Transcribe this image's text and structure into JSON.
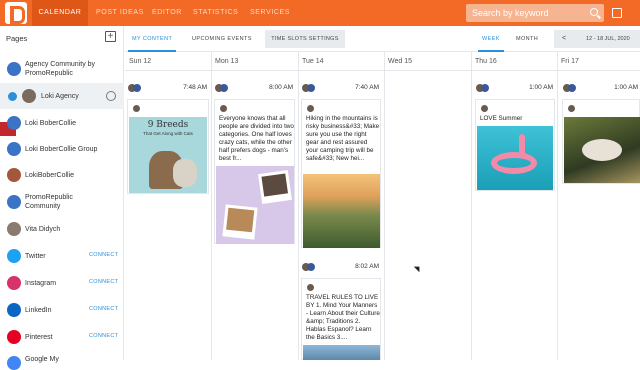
{
  "nav": {
    "tabs": [
      "CALENDAR",
      "POST IDEAS",
      "EDITOR",
      "STATISTICS",
      "SERVICES"
    ],
    "active": 0
  },
  "search": {
    "placeholder": "Search by keyword"
  },
  "sidebar": {
    "heading": "Pages",
    "items": [
      {
        "label": "Agency Community by PromoRepublic",
        "connect": ""
      },
      {
        "label": "Loki Agency",
        "connect": ""
      },
      {
        "label": "Loki BoberCollie",
        "connect": ""
      },
      {
        "label": "Loki BoberCollie Group",
        "connect": ""
      },
      {
        "label": "LokiBoberCollie",
        "connect": ""
      },
      {
        "label": "PromoRepublic Community",
        "connect": ""
      },
      {
        "label": "Vita Didych",
        "connect": ""
      },
      {
        "label": "Twitter",
        "connect": "CONNECT"
      },
      {
        "label": "Instagram",
        "connect": "CONNECT"
      },
      {
        "label": "LinkedIn",
        "connect": "CONNECT"
      },
      {
        "label": "Pinterest",
        "connect": "CONNECT"
      },
      {
        "label": "Google My",
        "connect": ""
      }
    ]
  },
  "subtabs": {
    "my_content": "MY CONTENT",
    "upcoming": "UPCOMING EVENTS",
    "time_slots": "TIME SLOTS SETTINGS",
    "week": "WEEK",
    "month": "MONTH",
    "range": "12 - 18 JUL, 2020",
    "prev": "<"
  },
  "days": [
    "Sun 12",
    "Mon 13",
    "Tue 14",
    "Wed 15",
    "Thu 16",
    "Fri 17"
  ],
  "posts": {
    "sun": {
      "time": "7:48 AM",
      "img_title": "9 Breeds",
      "img_sub": "That Get Along with Cats"
    },
    "mon": {
      "time": "8:00 AM",
      "text": "Everyone knows that all people are divided into two categories. One half loves crazy cats, while the other half prefers dogs - man's best fr..."
    },
    "tue1": {
      "time": "7:40 AM",
      "text": "Hiking in the mountains is risky business&#33; Make sure you use the right gear and rest assured your camping trip will be safe&#33; New hei..."
    },
    "tue2": {
      "time": "8:02 AM",
      "text": "TRAVEL RULES TO LIVE BY 1. Mind Your Manners - Learn About their Culture &amp; Traditions 2. Hablas Espanol? Learn the Basics 3...."
    },
    "thu": {
      "time": "1:00 AM",
      "text": "LOVE Summer"
    },
    "fri": {
      "time": "1:00 AM"
    }
  },
  "colors": {
    "brand": "#f26a25",
    "accent": "#2d8fd8"
  }
}
